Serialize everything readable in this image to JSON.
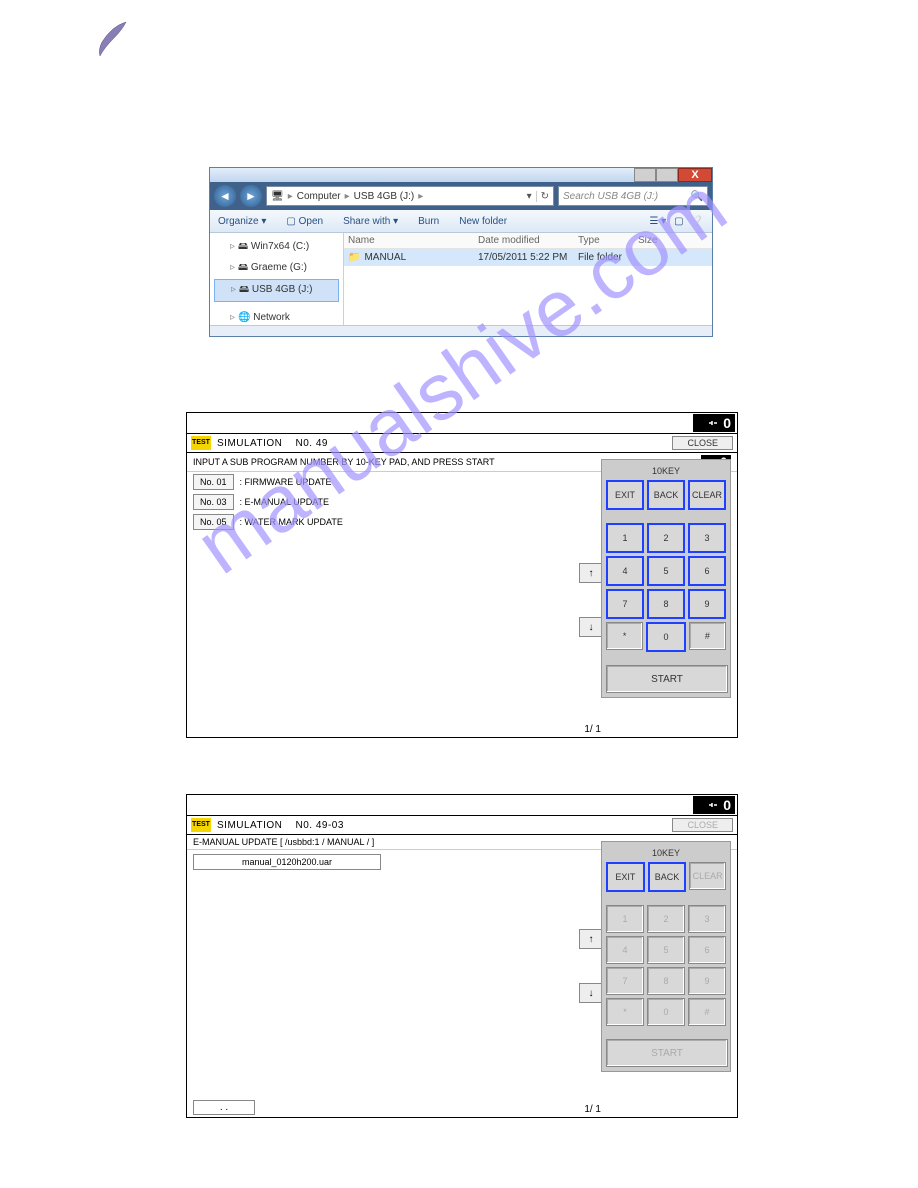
{
  "explorer": {
    "breadcrumb": {
      "root": "Computer",
      "drive": "USB 4GB (J:)"
    },
    "search_placeholder": "Search USB 4GB (J:)",
    "toolbar": {
      "organize": "Organize ▾",
      "open": "Open",
      "share": "Share with ▾",
      "burn": "Burn",
      "newfolder": "New folder"
    },
    "tree": {
      "item0": "Win7x64 (C:)",
      "item1": "Graeme (G:)",
      "item2": "USB 4GB (J:)",
      "network": "Network"
    },
    "cols": {
      "name": "Name",
      "date": "Date modified",
      "type": "Type",
      "size": "Size"
    },
    "row": {
      "name": "MANUAL",
      "date": "17/05/2011 5:22 PM",
      "type": "File folder"
    },
    "chrome": {
      "close": "X"
    }
  },
  "sim1": {
    "badge": "TEST",
    "title": "SIMULATION",
    "number": "N0. 49",
    "close": "CLOSE",
    "counter": "0",
    "subhead": "INPUT A SUB PROGRAM NUMBER BY 10-KEY PAD, AND PRESS START",
    "subcounter": "0",
    "opt1": {
      "btn": "No. 01",
      "label": ": FIRMWARE UPDATE"
    },
    "opt2": {
      "btn": "No. 03",
      "label": ": E-MANUAL UPDATE"
    },
    "opt3": {
      "btn": "No. 05",
      "label": ": WATER MARK UPDATE"
    },
    "page": "1/ 1"
  },
  "sim2": {
    "badge": "TEST",
    "title": "SIMULATION",
    "number": "N0. 49-03",
    "close": "CLOSE",
    "counter": "0",
    "subhead": "E-MANUAL UPDATE    [ /usbbd:1 / MANUAL / ]",
    "file": "manual_0120h200.uar",
    "page": "1/ 1",
    "dotdot": ". ."
  },
  "keypad": {
    "title": "10KEY",
    "exit": "EXIT",
    "back": "BACK",
    "clear": "CLEAR",
    "k1": "1",
    "k2": "2",
    "k3": "3",
    "k4": "4",
    "k5": "5",
    "k6": "6",
    "k7": "7",
    "k8": "8",
    "k9": "9",
    "kstar": "*",
    "k0": "0",
    "khash": "#",
    "start": "START"
  }
}
